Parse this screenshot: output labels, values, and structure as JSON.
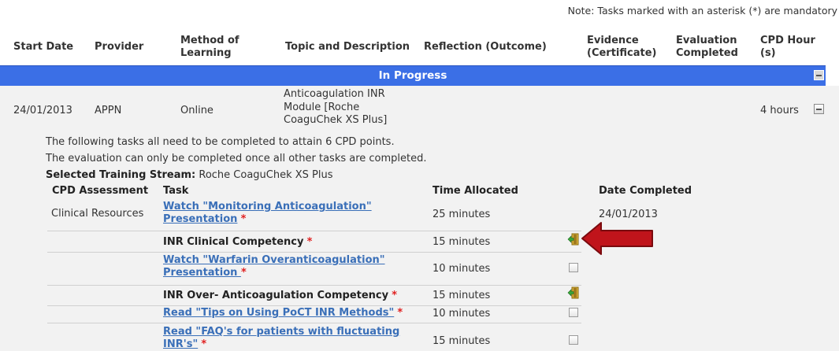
{
  "note": "Note: Tasks marked with an asterisk (*) are mandatory",
  "columns": {
    "start_date": "Start Date",
    "provider": "Provider",
    "method": "Method of Learning",
    "topic": "Topic and Description",
    "reflection": "Reflection (Outcome)",
    "evidence": "Evidence (Certificate)",
    "evaluation": "Evaluation Completed",
    "cpd": "CPD Hour (s)"
  },
  "section_title": "In Progress",
  "entry": {
    "start_date": "24/01/2013",
    "provider": "APPN",
    "method": "Online",
    "topic": "Anticoagulation INR Module [Roche CoaguChek XS Plus]",
    "cpd_hours": "4 hours"
  },
  "info": {
    "line1": "The following tasks all need to be completed to attain 6 CPD points.",
    "line2": "The evaluation can only be completed once all other tasks are completed.",
    "stream_label": "Selected Training Stream:",
    "stream_value": "Roche CoaguChek XS Plus"
  },
  "task_columns": {
    "assessment": "CPD Assessment",
    "task": "Task",
    "time": "Time Allocated",
    "date": "Date Completed"
  },
  "tasks": [
    {
      "assessment": "Clinical Resources",
      "task": "Watch \"Monitoring Anticoagulation\" Presentation",
      "star": "*",
      "time": "25 minutes",
      "date": "24/01/2013"
    },
    {
      "assessment": "",
      "task": "INR Clinical Competency",
      "star": "*",
      "time": "15 minutes",
      "date": ""
    },
    {
      "assessment": "",
      "task": "Watch \"Warfarin Overanticoagulation\" Presentation ",
      "star": "*",
      "time": "10 minutes",
      "date": ""
    },
    {
      "assessment": "",
      "task": "INR Over- Anticoagulation Competency",
      "star": "*",
      "time": "15 minutes",
      "date": ""
    },
    {
      "assessment": "",
      "task": "Read \"Tips on Using PoCT INR Methods\"",
      "star": "*",
      "time": "10 minutes",
      "date": ""
    },
    {
      "assessment": "",
      "task": "Read \"FAQ's for patients with fluctuating INR's\"",
      "star": "*",
      "time": "15 minutes",
      "date": ""
    }
  ],
  "colors": {
    "bar": "#3b6fe6",
    "link": "#3a6fb8",
    "arrow": "#c0141b",
    "star": "#e02020"
  }
}
